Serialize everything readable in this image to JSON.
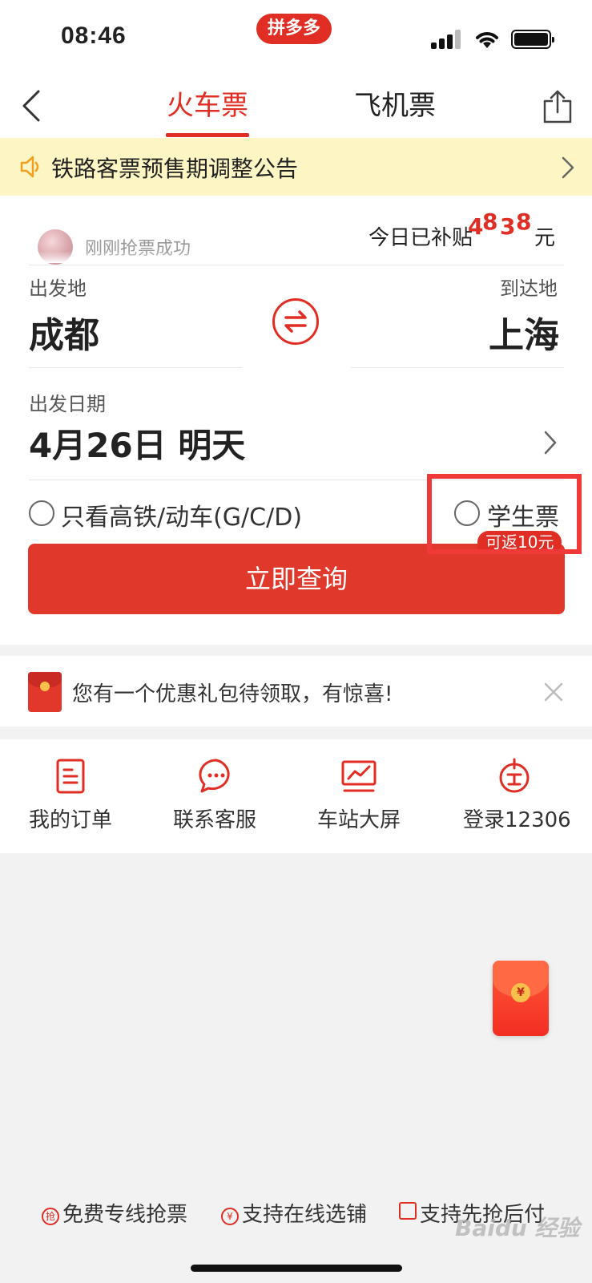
{
  "status_bar": {
    "time": "08:46",
    "app_badge": "拼多多"
  },
  "nav": {
    "tabs": [
      {
        "label": "火车票",
        "active": true
      },
      {
        "label": "飞机票",
        "active": false
      }
    ]
  },
  "notice": {
    "text": "铁路客票预售期调整公告"
  },
  "ticker": {
    "text": "刚刚抢票成功",
    "subsidy_label": "今日已补贴",
    "subsidy_digits": [
      "4",
      "8",
      "3",
      "8"
    ],
    "subsidy_unit": "元"
  },
  "route": {
    "from_label": "出发地",
    "from_city": "成都",
    "to_label": "到达地",
    "to_city": "上海"
  },
  "date": {
    "label": "出发日期",
    "value": "4月26日 明天"
  },
  "options": {
    "high_speed_only": "只看高铁/动车(G/C/D)",
    "student_ticket": "学生票",
    "student_tag": "可返10元"
  },
  "search_button": "立即查询",
  "promo": {
    "text": "您有一个优惠礼包待领取，有惊喜!"
  },
  "menu": [
    {
      "label": "我的订单",
      "icon": "order-icon"
    },
    {
      "label": "联系客服",
      "icon": "chat-icon"
    },
    {
      "label": "车站大屏",
      "icon": "screen-icon"
    },
    {
      "label": "登录12306",
      "icon": "login-icon"
    }
  ],
  "features": [
    {
      "badge": "抢",
      "label": "免费专线抢票"
    },
    {
      "badge": "¥",
      "label": "支持在线选铺"
    },
    {
      "badge": "",
      "label": "支持先抢后付"
    }
  ],
  "watermark": "Baidu 经验",
  "colors": {
    "accent": "#e02e24",
    "notice_bg": "#fdf5c3",
    "highlight": "#f03a3a"
  }
}
